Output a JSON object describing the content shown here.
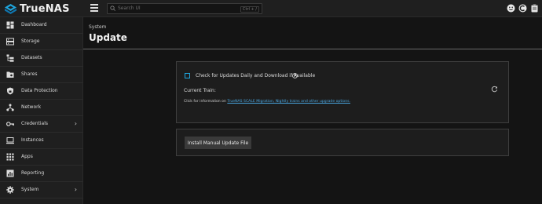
{
  "app": {
    "brand": "TrueNAS"
  },
  "search": {
    "placeholder": "Search UI",
    "shortcut": "Ctrl + /"
  },
  "sidebar": {
    "items": [
      {
        "label": "Dashboard",
        "icon": "dashboard-icon"
      },
      {
        "label": "Storage",
        "icon": "storage-icon"
      },
      {
        "label": "Datasets",
        "icon": "datasets-icon"
      },
      {
        "label": "Shares",
        "icon": "shares-icon"
      },
      {
        "label": "Data Protection",
        "icon": "data-protection-icon"
      },
      {
        "label": "Network",
        "icon": "network-icon"
      },
      {
        "label": "Credentials",
        "icon": "credentials-icon",
        "expandable": true
      },
      {
        "label": "Instances",
        "icon": "instances-icon"
      },
      {
        "label": "Apps",
        "icon": "apps-icon"
      },
      {
        "label": "Reporting",
        "icon": "reporting-icon"
      },
      {
        "label": "System",
        "icon": "system-icon",
        "expandable": true
      }
    ]
  },
  "header": {
    "breadcrumb": "System",
    "title": "Update"
  },
  "update_card": {
    "checkbox_label": "Check for Updates Daily and Download if Available",
    "checkbox_checked": false,
    "current_train_label": "Current Train:",
    "info_prefix": "Click for information on ",
    "info_link": "TrueNAS SCALE Migration, Nightly trains and other upgrade options."
  },
  "manual_card": {
    "button_label": "Install Manual Update File"
  },
  "colors": {
    "accent": "#1ea7e0",
    "link": "#4aa6e0",
    "background": "#141414",
    "panel": "#1f1f1f"
  }
}
